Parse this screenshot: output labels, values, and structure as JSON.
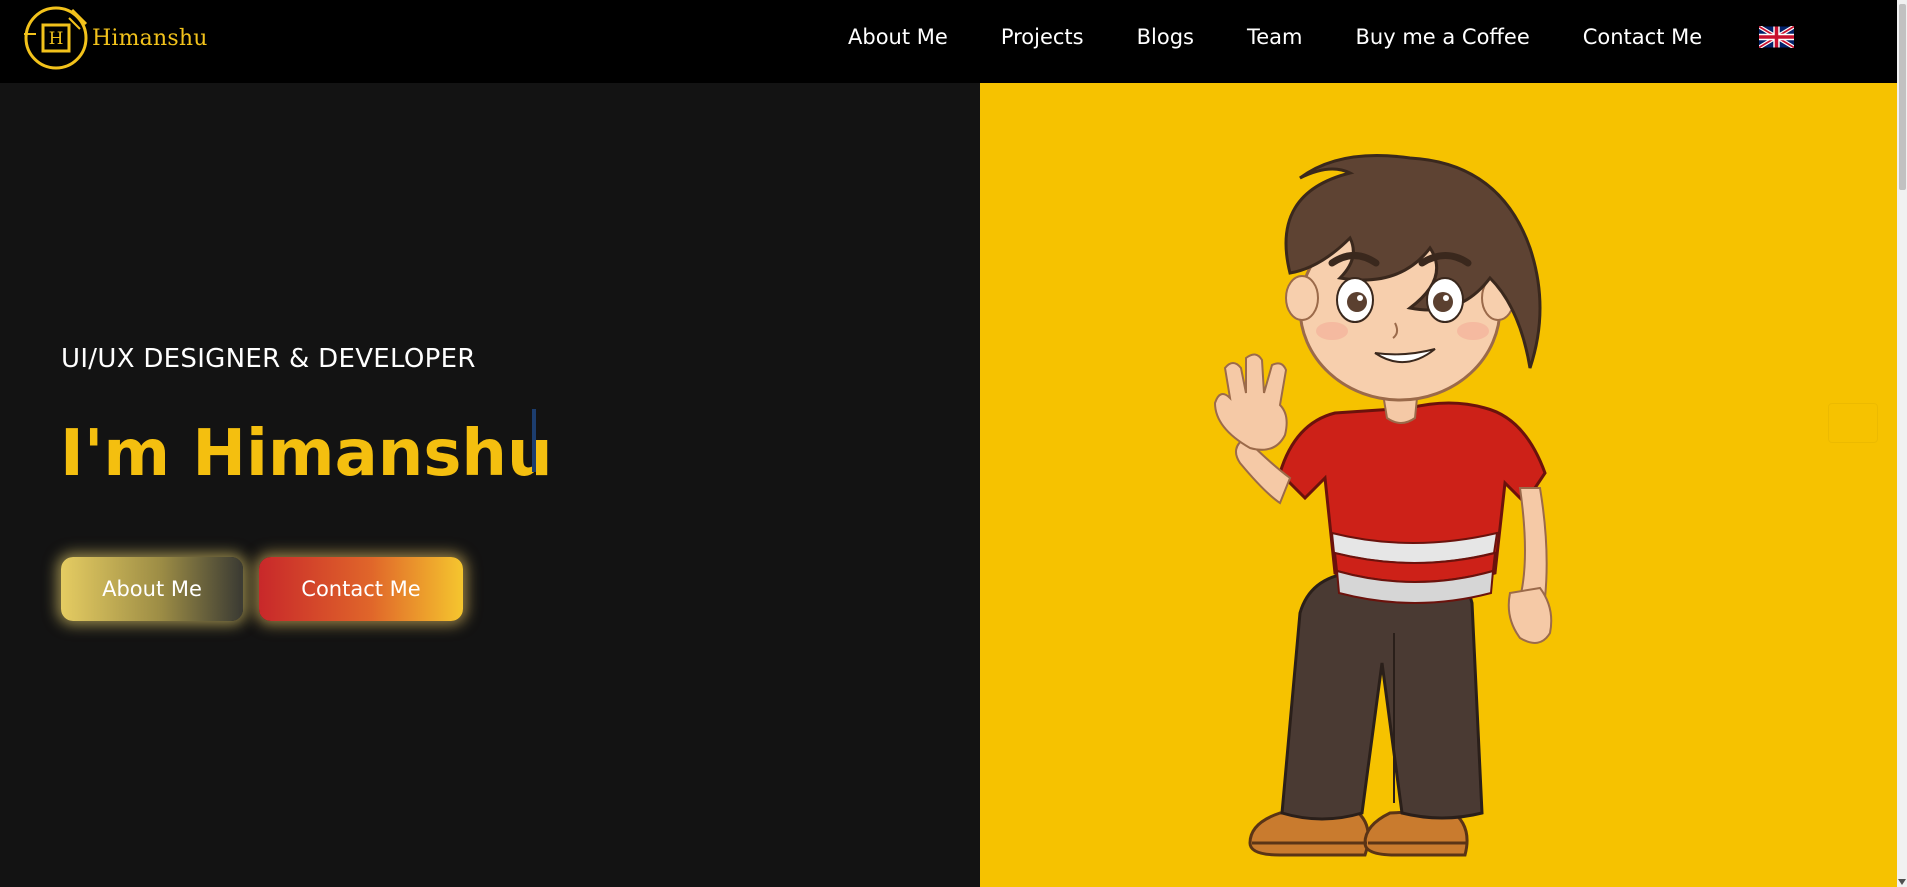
{
  "brand": {
    "name": "Himanshu",
    "monogram": "H",
    "color": "#f2c21b"
  },
  "nav": {
    "items": [
      {
        "label": "About Me"
      },
      {
        "label": "Projects"
      },
      {
        "label": "Blogs"
      },
      {
        "label": "Team"
      },
      {
        "label": "Buy me a Coffee"
      },
      {
        "label": "Contact Me"
      }
    ],
    "language_icon": "uk-flag-icon"
  },
  "hero": {
    "subtitle": "UI/UX DESIGNER & DEVELOPER",
    "headline": "I'm Himanshu",
    "buttons": {
      "about": "About Me",
      "contact": "Contact Me"
    },
    "illustration": "cartoon-boy-waving",
    "accent_color": "#f4bf0f",
    "panel_color": "#f6c200"
  }
}
